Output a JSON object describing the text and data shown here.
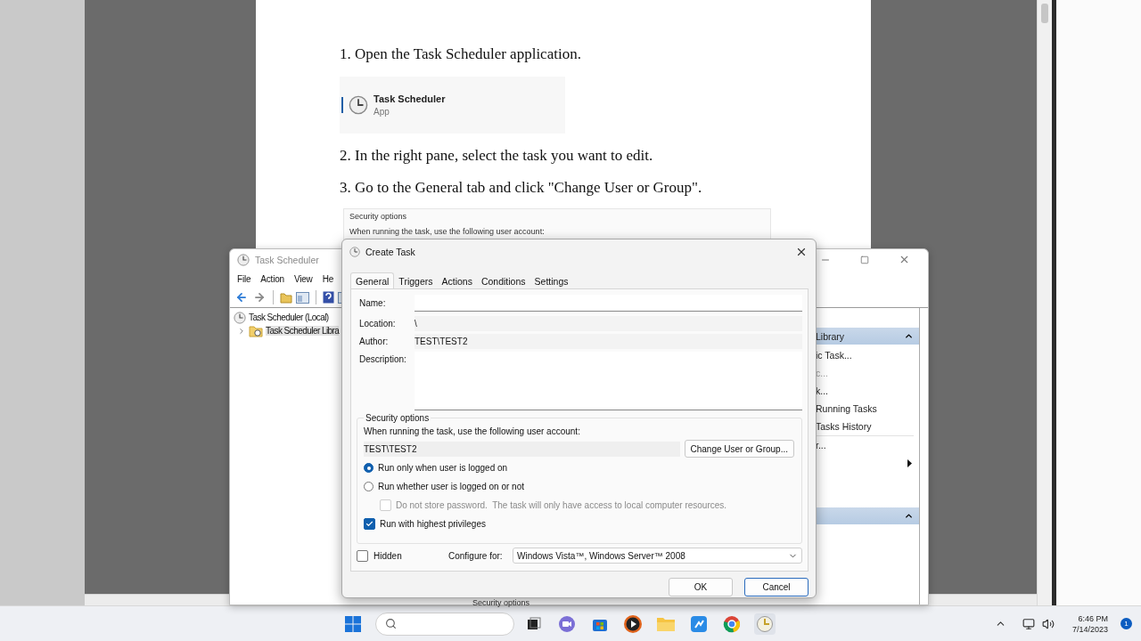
{
  "document": {
    "steps": [
      "1. Open the Task Scheduler application.",
      "2. In the right pane, select the task you want to edit.",
      "3. Go to the General tab and click \"Change User or Group\"."
    ],
    "app_card": {
      "title": "Task Scheduler",
      "subtitle": "App"
    },
    "snippet": {
      "title": "Security options",
      "text": "When running the task, use the following user account:"
    }
  },
  "task_scheduler": {
    "title": "Task Scheduler",
    "menu": [
      "File",
      "Action",
      "View",
      "He"
    ],
    "tree": [
      {
        "label": "Task Scheduler (Local)",
        "kind": "clock",
        "children": [
          {
            "label": "Task Scheduler Libra",
            "kind": "folder",
            "expanded": false
          }
        ]
      }
    ],
    "actions": [
      {
        "kind": "header",
        "label": "Library"
      },
      {
        "kind": "item",
        "label": "ic Task...",
        "disabled": false
      },
      {
        "kind": "item",
        "label": "c...",
        "disabled": true
      },
      {
        "kind": "item",
        "label": "k...",
        "disabled": false
      },
      {
        "kind": "item",
        "label": "Running Tasks",
        "disabled": false
      },
      {
        "kind": "item",
        "label": "Tasks History",
        "disabled": false
      },
      {
        "kind": "separator"
      },
      {
        "kind": "item",
        "label": "r...",
        "disabled": false
      },
      {
        "kind": "submenu"
      },
      {
        "kind": "blank"
      },
      {
        "kind": "blank"
      },
      {
        "kind": "header"
      }
    ],
    "footer_text": "Security options"
  },
  "dialog": {
    "title": "Create Task",
    "tabs": [
      {
        "label": "General",
        "selected": true
      },
      {
        "label": "Triggers",
        "selected": false
      },
      {
        "label": "Actions",
        "selected": false
      },
      {
        "label": "Conditions",
        "selected": false
      },
      {
        "label": "Settings",
        "selected": false
      }
    ],
    "name_label": "Name:",
    "location_label": "Location:",
    "location": "\\",
    "author_label": "Author:",
    "author": "TEST\\TEST2",
    "description_label": "Description:",
    "security": {
      "title": "Security options",
      "account_prompt": "When running the task, use the following user account:",
      "account": "TEST\\TEST2",
      "change_button": "Change User or Group...",
      "options": [
        {
          "kind": "radio",
          "label": "Run only when user is logged on",
          "selected": true
        },
        {
          "kind": "radio",
          "label": "Run whether user is logged on or not",
          "selected": false,
          "children": [
            {
              "kind": "checkbox",
              "label": "Do not store password.  The task will only have access to local computer resources.",
              "checked": false,
              "disabled": true
            }
          ]
        },
        {
          "kind": "checkbox",
          "label": "Run with highest privileges",
          "checked": true,
          "disabled": false
        }
      ]
    },
    "hidden": {
      "label": "Hidden",
      "checked": false
    },
    "configure_label": "Configure for:",
    "configure_value": "Windows Vista™, Windows Server™ 2008",
    "buttons": [
      {
        "label": "OK",
        "focused": false
      },
      {
        "label": "Cancel",
        "focused": true
      }
    ]
  },
  "taskbar": {
    "time": "6:46 PM",
    "date": "7/14/2023",
    "notifications": "1"
  }
}
